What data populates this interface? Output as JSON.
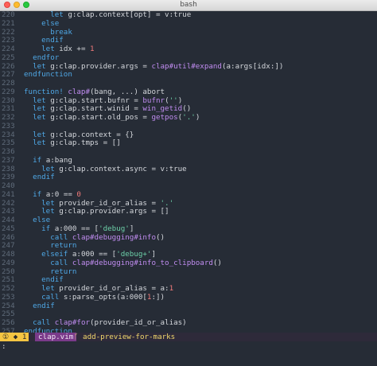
{
  "window": {
    "title": "bash"
  },
  "statusline": {
    "mode": "① ◆ 1",
    "filename": "clap.vim",
    "branch_icon": "branch-icon",
    "branch": " add-preview-for-marks"
  },
  "cmdline": {
    "text": ":"
  },
  "colors": {
    "background": "#262c36",
    "keyword": "#4fa8e6",
    "function": "#c08cf0",
    "string": "#6ccfa8",
    "number": "#f07a7a",
    "line_number": "#5f6b7a",
    "status_mode": "#f5c542",
    "status_file": "#7a3a8a"
  },
  "lines": [
    {
      "n": "220",
      "tokens": [
        [
          "      ",
          "var"
        ],
        [
          "let ",
          "kw"
        ],
        [
          "g:clap.context[opt] = v:true",
          "var"
        ]
      ]
    },
    {
      "n": "221",
      "tokens": [
        [
          "    ",
          "var"
        ],
        [
          "else",
          "kw"
        ]
      ]
    },
    {
      "n": "222",
      "tokens": [
        [
          "      ",
          "var"
        ],
        [
          "break",
          "kw"
        ]
      ]
    },
    {
      "n": "223",
      "tokens": [
        [
          "    ",
          "var"
        ],
        [
          "endif",
          "kw"
        ]
      ]
    },
    {
      "n": "224",
      "tokens": [
        [
          "    ",
          "var"
        ],
        [
          "let ",
          "kw"
        ],
        [
          "idx += ",
          "var"
        ],
        [
          "1",
          "num"
        ]
      ]
    },
    {
      "n": "225",
      "tokens": [
        [
          "  ",
          "var"
        ],
        [
          "endfor",
          "kw"
        ]
      ]
    },
    {
      "n": "226",
      "tokens": [
        [
          "  ",
          "var"
        ],
        [
          "let ",
          "kw"
        ],
        [
          "g:clap.provider.args = ",
          "var"
        ],
        [
          "clap#util#expand",
          "fn"
        ],
        [
          "(a:args[idx:])",
          "var"
        ]
      ]
    },
    {
      "n": "227",
      "tokens": [
        [
          "endfunction",
          "kw"
        ]
      ]
    },
    {
      "n": "228",
      "tokens": []
    },
    {
      "n": "229",
      "tokens": [
        [
          "function! ",
          "kw"
        ],
        [
          "clap#",
          "fn"
        ],
        [
          "(bang, ...) abort",
          "var"
        ]
      ]
    },
    {
      "n": "230",
      "tokens": [
        [
          "  ",
          "var"
        ],
        [
          "let ",
          "kw"
        ],
        [
          "g:clap.start.bufnr = ",
          "var"
        ],
        [
          "bufnr",
          "fn"
        ],
        [
          "(",
          "var"
        ],
        [
          "''",
          "str"
        ],
        [
          ")",
          "var"
        ]
      ]
    },
    {
      "n": "231",
      "tokens": [
        [
          "  ",
          "var"
        ],
        [
          "let ",
          "kw"
        ],
        [
          "g:clap.start.winid = ",
          "var"
        ],
        [
          "win_getid",
          "fn"
        ],
        [
          "()",
          "var"
        ]
      ]
    },
    {
      "n": "232",
      "tokens": [
        [
          "  ",
          "var"
        ],
        [
          "let ",
          "kw"
        ],
        [
          "g:clap.start.old_pos = ",
          "var"
        ],
        [
          "getpos",
          "fn"
        ],
        [
          "(",
          "var"
        ],
        [
          "'.'",
          "str"
        ],
        [
          ")",
          "var"
        ]
      ]
    },
    {
      "n": "233",
      "tokens": []
    },
    {
      "n": "234",
      "tokens": [
        [
          "  ",
          "var"
        ],
        [
          "let ",
          "kw"
        ],
        [
          "g:clap.context = {}",
          "var"
        ]
      ]
    },
    {
      "n": "235",
      "tokens": [
        [
          "  ",
          "var"
        ],
        [
          "let ",
          "kw"
        ],
        [
          "g:clap.tmps = []",
          "var"
        ]
      ]
    },
    {
      "n": "236",
      "tokens": []
    },
    {
      "n": "237",
      "tokens": [
        [
          "  ",
          "var"
        ],
        [
          "if ",
          "kw"
        ],
        [
          "a:bang",
          "var"
        ]
      ]
    },
    {
      "n": "238",
      "tokens": [
        [
          "    ",
          "var"
        ],
        [
          "let ",
          "kw"
        ],
        [
          "g:clap.context.async = v:true",
          "var"
        ]
      ]
    },
    {
      "n": "239",
      "tokens": [
        [
          "  ",
          "var"
        ],
        [
          "endif",
          "kw"
        ]
      ]
    },
    {
      "n": "240",
      "tokens": []
    },
    {
      "n": "241",
      "tokens": [
        [
          "  ",
          "var"
        ],
        [
          "if ",
          "kw"
        ],
        [
          "a:0 == ",
          "var"
        ],
        [
          "0",
          "num"
        ]
      ]
    },
    {
      "n": "242",
      "tokens": [
        [
          "    ",
          "var"
        ],
        [
          "let ",
          "kw"
        ],
        [
          "provider_id_or_alias = ",
          "var"
        ],
        [
          "'.'",
          "str"
        ]
      ]
    },
    {
      "n": "243",
      "tokens": [
        [
          "    ",
          "var"
        ],
        [
          "let ",
          "kw"
        ],
        [
          "g:clap.provider.args = []",
          "var"
        ]
      ]
    },
    {
      "n": "244",
      "tokens": [
        [
          "  ",
          "var"
        ],
        [
          "else",
          "kw"
        ]
      ]
    },
    {
      "n": "245",
      "tokens": [
        [
          "    ",
          "var"
        ],
        [
          "if ",
          "kw"
        ],
        [
          "a:000 == [",
          "var"
        ],
        [
          "'debug'",
          "str"
        ],
        [
          "]",
          "var"
        ]
      ]
    },
    {
      "n": "246",
      "tokens": [
        [
          "      ",
          "var"
        ],
        [
          "call ",
          "kw"
        ],
        [
          "clap#debugging#info",
          "fn"
        ],
        [
          "()",
          "var"
        ]
      ]
    },
    {
      "n": "247",
      "tokens": [
        [
          "      ",
          "var"
        ],
        [
          "return",
          "kw"
        ]
      ]
    },
    {
      "n": "248",
      "tokens": [
        [
          "    ",
          "var"
        ],
        [
          "elseif ",
          "kw"
        ],
        [
          "a:000 == [",
          "var"
        ],
        [
          "'debug+'",
          "str"
        ],
        [
          "]",
          "var"
        ]
      ]
    },
    {
      "n": "249",
      "tokens": [
        [
          "      ",
          "var"
        ],
        [
          "call ",
          "kw"
        ],
        [
          "clap#debugging#info_to_clipboard",
          "fn"
        ],
        [
          "()",
          "var"
        ]
      ]
    },
    {
      "n": "250",
      "tokens": [
        [
          "      ",
          "var"
        ],
        [
          "return",
          "kw"
        ]
      ]
    },
    {
      "n": "251",
      "tokens": [
        [
          "    ",
          "var"
        ],
        [
          "endif",
          "kw"
        ]
      ]
    },
    {
      "n": "252",
      "tokens": [
        [
          "    ",
          "var"
        ],
        [
          "let ",
          "kw"
        ],
        [
          "provider_id_or_alias = a:",
          "var"
        ],
        [
          "1",
          "num"
        ]
      ]
    },
    {
      "n": "253",
      "tokens": [
        [
          "    ",
          "var"
        ],
        [
          "call ",
          "kw"
        ],
        [
          "s:parse_opts(a:000[",
          "var"
        ],
        [
          "1",
          "num"
        ],
        [
          ":])",
          "var"
        ]
      ]
    },
    {
      "n": "254",
      "tokens": [
        [
          "  ",
          "var"
        ],
        [
          "endif",
          "kw"
        ]
      ]
    },
    {
      "n": "255",
      "tokens": []
    },
    {
      "n": "256",
      "tokens": [
        [
          "  ",
          "var"
        ],
        [
          "call ",
          "kw"
        ],
        [
          "clap#for",
          "fn"
        ],
        [
          "(provider_id_or_alias)",
          "var"
        ]
      ]
    },
    {
      "n": "257",
      "tokens": [
        [
          "endfunction",
          "kw"
        ]
      ]
    },
    {
      "n": "258",
      "tokens": []
    },
    {
      "n": "259",
      "tokens": [
        [
          "let ",
          "kw"
        ],
        [
          "&cpo = s:save_cpo",
          "var"
        ]
      ]
    },
    {
      "n": "260",
      "tokens": [
        [
          "unlet ",
          "kw"
        ],
        [
          "s:save_cpo",
          "var"
        ]
      ]
    }
  ]
}
